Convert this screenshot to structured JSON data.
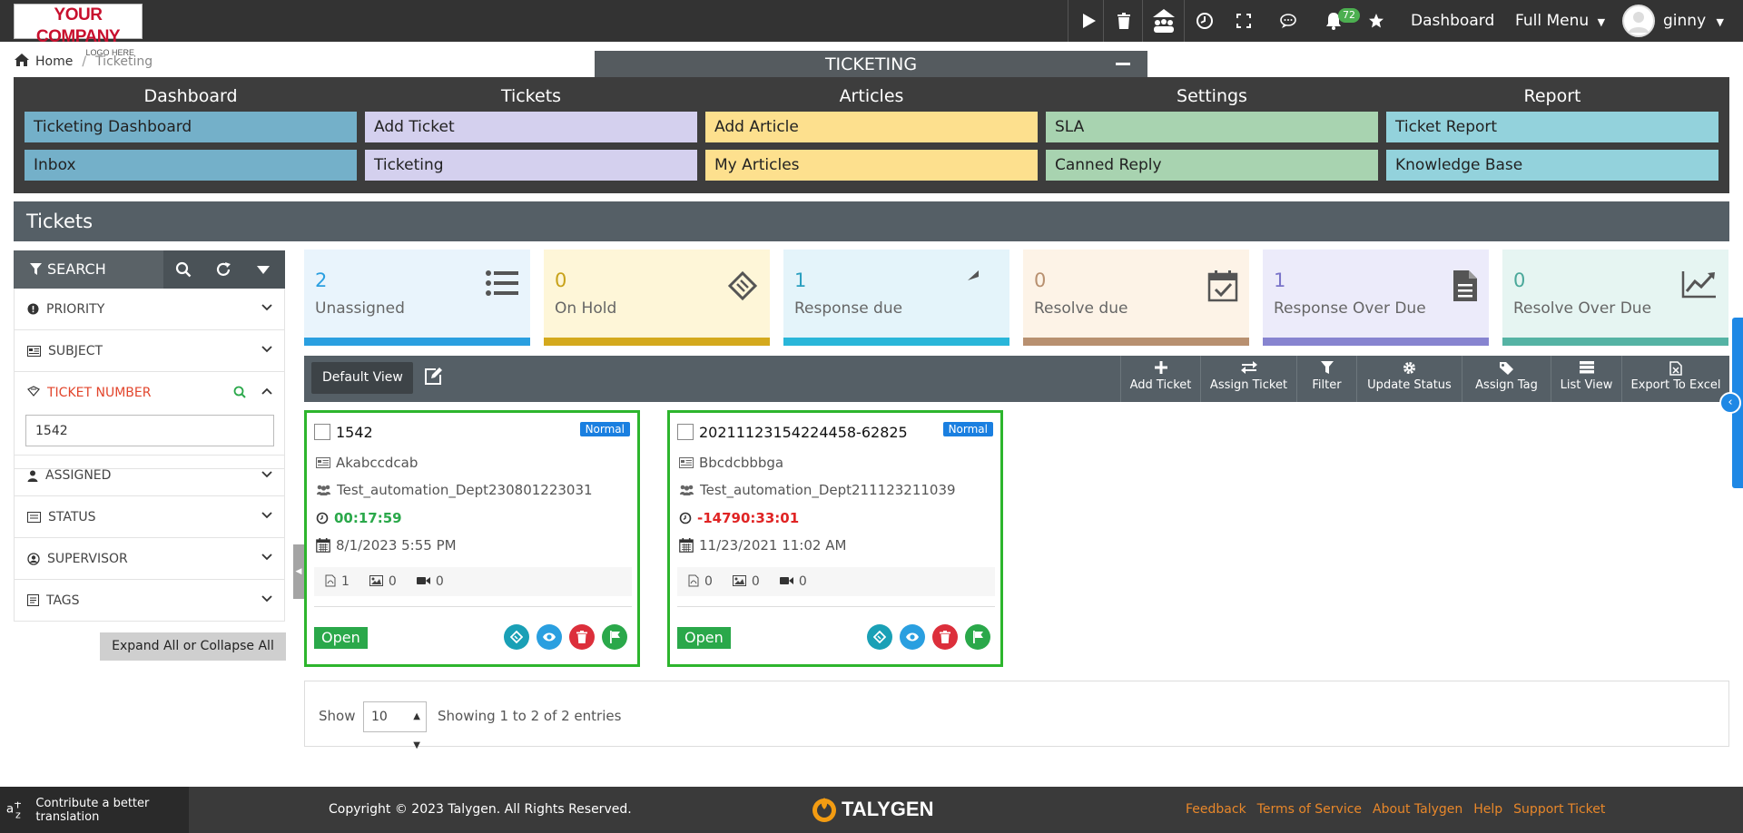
{
  "logo": {
    "line1": "YOUR COMPANY",
    "line2": "LOGO HERE"
  },
  "topbar": {
    "notification_count": "72",
    "dashboard_label": "Dashboard",
    "full_menu_label": "Full Menu",
    "user_name": "ginny"
  },
  "breadcrumb": {
    "home": "Home",
    "separator": "/",
    "current": "Ticketing"
  },
  "module": {
    "title": "TICKETING",
    "columns": [
      {
        "header": "Dashboard",
        "items": [
          "Ticketing Dashboard",
          "Inbox"
        ]
      },
      {
        "header": "Tickets",
        "items": [
          "Add Ticket",
          "Ticketing"
        ]
      },
      {
        "header": "Articles",
        "items": [
          "Add Article",
          "My Articles"
        ]
      },
      {
        "header": "Settings",
        "items": [
          "SLA",
          "Canned Reply"
        ]
      },
      {
        "header": "Report",
        "items": [
          "Ticket Report",
          "Knowledge Base"
        ]
      }
    ]
  },
  "page_title": "Tickets",
  "search": {
    "label": "SEARCH",
    "filters": [
      "PRIORITY",
      "SUBJECT",
      "TICKET NUMBER",
      "ASSIGNED",
      "STATUS",
      "SUPERVISOR",
      "TAGS"
    ],
    "ticket_number_value": "1542",
    "expand_label": "Expand All or Collapse All"
  },
  "stats": [
    {
      "value": "2",
      "label": "Unassigned"
    },
    {
      "value": "0",
      "label": "On Hold"
    },
    {
      "value": "1",
      "label": "Response due"
    },
    {
      "value": "0",
      "label": "Resolve due"
    },
    {
      "value": "1",
      "label": "Response Over Due"
    },
    {
      "value": "0",
      "label": "Resolve Over Due"
    }
  ],
  "toolbar": {
    "view_label": "Default View",
    "buttons": [
      "Add Ticket",
      "Assign Ticket",
      "Filter",
      "Update Status",
      "Assign Tag",
      "List View",
      "Export To Excel"
    ]
  },
  "tickets": [
    {
      "number": "1542",
      "priority": "Normal",
      "subject": "Akabccdcab",
      "department": "Test_automation_Dept230801223031",
      "timer": "00:17:59",
      "date": "8/1/2023 5:55 PM",
      "docs": "1",
      "images": "0",
      "videos": "0",
      "status": "Open"
    },
    {
      "number": "20211123154224458-62825",
      "priority": "Normal",
      "subject": "Bbcdcbbbga",
      "department": "Test_automation_Dept211123211039",
      "timer": "-14790:33:01",
      "date": "11/23/2021 11:02 AM",
      "docs": "0",
      "images": "0",
      "videos": "0",
      "status": "Open"
    }
  ],
  "pager": {
    "show": "Show",
    "page_size": "10",
    "summary": "Showing 1 to 2 of 2 entries"
  },
  "footer": {
    "translate": "Contribute a better translation",
    "copyright": "Copyright © 2023 Talygen. All Rights Reserved.",
    "brand": "TALYGEN",
    "links": [
      "Feedback",
      "Terms of Service",
      "About Talygen",
      "Help",
      "Support Ticket"
    ]
  },
  "colors": {
    "dashboard_tile": "#74b0c9",
    "tickets_tile": "#d4d0ee",
    "articles_tile": "#fde08e",
    "settings_tile": "#a8d3b0",
    "report_tile": "#93d2dc",
    "timer_positive": "#2aa84a",
    "timer_negative": "#e02424"
  }
}
